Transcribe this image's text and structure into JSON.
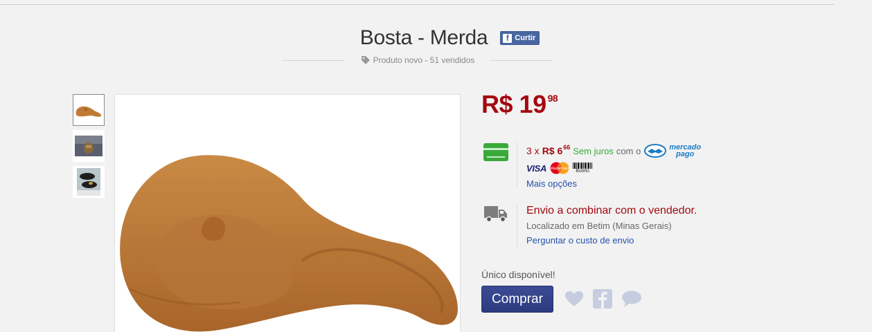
{
  "product": {
    "title": "Bosta - Merda",
    "subtitle": "Produto novo - 51 vendidos",
    "like_label": "Curtir"
  },
  "gallery": {
    "thumbnails": [
      "thumb-poop",
      "thumb-photo-2",
      "thumb-photo-3"
    ],
    "selected_index": 0
  },
  "price": {
    "currency": "R$",
    "whole": "19",
    "cents": "98"
  },
  "payment": {
    "installments_count": "3 x",
    "installment_value": "R$ 6",
    "installment_cents": "66",
    "interest_text": "Sem juros",
    "with_text": "com o",
    "provider_line1": "mercado",
    "provider_line2": "pago",
    "brands": [
      "VISA",
      "MasterCard",
      "Boleto"
    ],
    "more_options": "Mais opções"
  },
  "shipping": {
    "title": "Envio a combinar com o vendedor.",
    "location": "Localizado em Betim (Minas Gerais)",
    "ask_link": "Perguntar o custo de envio"
  },
  "purchase": {
    "stock_text": "Único disponível!",
    "buy_label": "Comprar"
  },
  "colors": {
    "price_red": "#a3090f",
    "link_blue": "#2451ab",
    "button_blue": "#2d3b7e",
    "green": "#3aa93a"
  }
}
